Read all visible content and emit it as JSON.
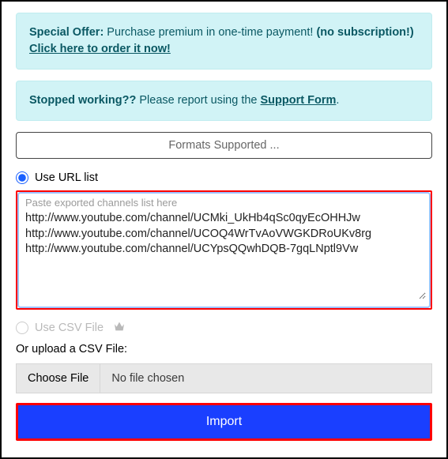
{
  "alerts": {
    "special_offer_bold": "Special Offer:",
    "special_offer_text": " Purchase premium in one-time payment! ",
    "special_offer_paren": "(no subscription!)",
    "special_offer_link": "Click here to order it now!",
    "stopped_bold": "Stopped working??",
    "stopped_text": " Please report using the ",
    "stopped_link": "Support Form",
    "stopped_period": "."
  },
  "formats_btn": "Formats Supported ...",
  "radio_url_label": "Use URL list",
  "textarea_placeholder": "Paste exported channels list here",
  "textarea_value": "http://www.youtube.com/channel/UCMki_UkHb4qSc0qyEcOHHJw\nhttp://www.youtube.com/channel/UCOQ4WrTvAoVWGKDRoUKv8rg\nhttp://www.youtube.com/channel/UCYpsQQwhDQB-7gqLNptl9Vw",
  "radio_csv_label": "Use CSV File",
  "upload_label": "Or upload a CSV File:",
  "file_choose": "Choose File",
  "file_status": "No file chosen",
  "import_btn": "Import"
}
